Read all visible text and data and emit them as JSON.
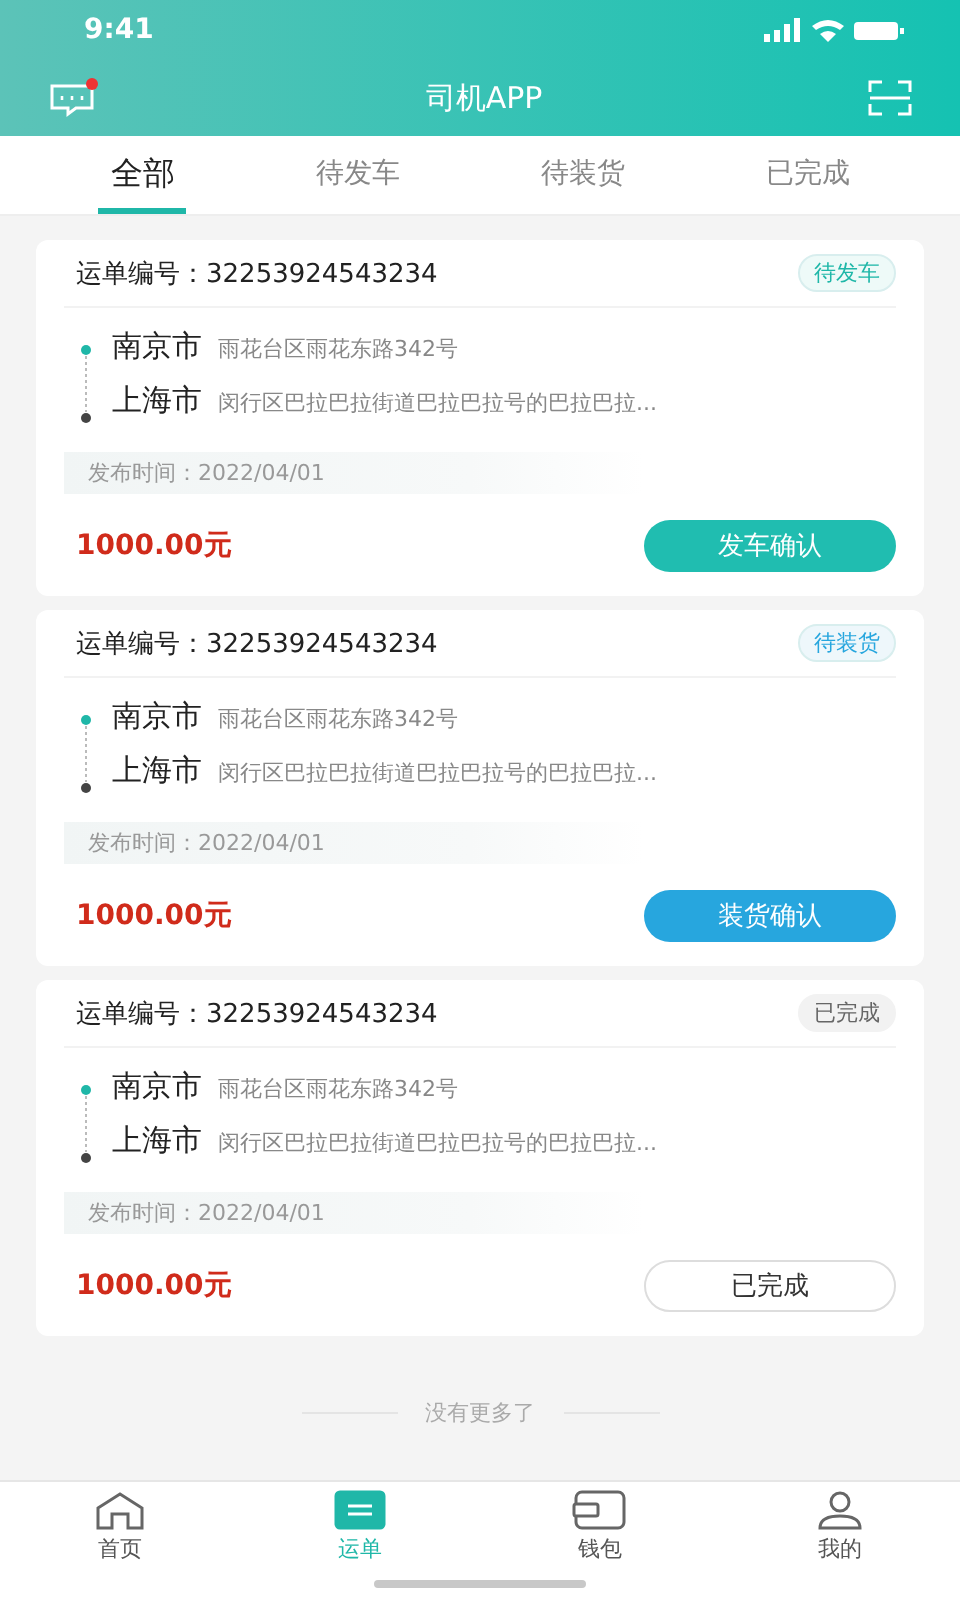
{
  "status_bar": {
    "time": "9:41"
  },
  "header": {
    "title": "司机APP",
    "has_unread": true
  },
  "tabs": [
    {
      "label": "全部",
      "selected": true
    },
    {
      "label": "待发车",
      "selected": false
    },
    {
      "label": "待装货",
      "selected": false
    },
    {
      "label": "已完成",
      "selected": false
    }
  ],
  "orders": [
    {
      "kind": "depart",
      "number_label": "运单编号：",
      "number": "32253924543234",
      "status": "待发车",
      "from_city": "南京市",
      "from_address": "雨花台区雨花东路342号",
      "to_city": "上海市",
      "to_address": "闵行区巴拉巴拉街道巴拉巴拉号的巴拉巴拉...",
      "time_label": "发布时间：",
      "time": "2022/04/01",
      "price": "1000.00元",
      "action": "发车确认"
    },
    {
      "kind": "load",
      "number_label": "运单编号：",
      "number": "32253924543234",
      "status": "待装货",
      "from_city": "南京市",
      "from_address": "雨花台区雨花东路342号",
      "to_city": "上海市",
      "to_address": "闵行区巴拉巴拉街道巴拉巴拉号的巴拉巴拉...",
      "time_label": "发布时间：",
      "time": "2022/04/01",
      "price": "1000.00元",
      "action": "装货确认"
    },
    {
      "kind": "done",
      "number_label": "运单编号：",
      "number": "32253924543234",
      "status": "已完成",
      "from_city": "南京市",
      "from_address": "雨花台区雨花东路342号",
      "to_city": "上海市",
      "to_address": "闵行区巴拉巴拉街道巴拉巴拉号的巴拉巴拉...",
      "time_label": "发布时间：",
      "time": "2022/04/01",
      "price": "1000.00元",
      "action": "已完成"
    }
  ],
  "end_text": "没有更多了",
  "bottom_nav": [
    {
      "kind": "home",
      "label": "首页",
      "selected": false
    },
    {
      "kind": "orders",
      "label": "运单",
      "selected": true
    },
    {
      "kind": "wallet",
      "label": "钱包",
      "selected": false
    },
    {
      "kind": "profile",
      "label": "我的",
      "selected": false
    }
  ]
}
